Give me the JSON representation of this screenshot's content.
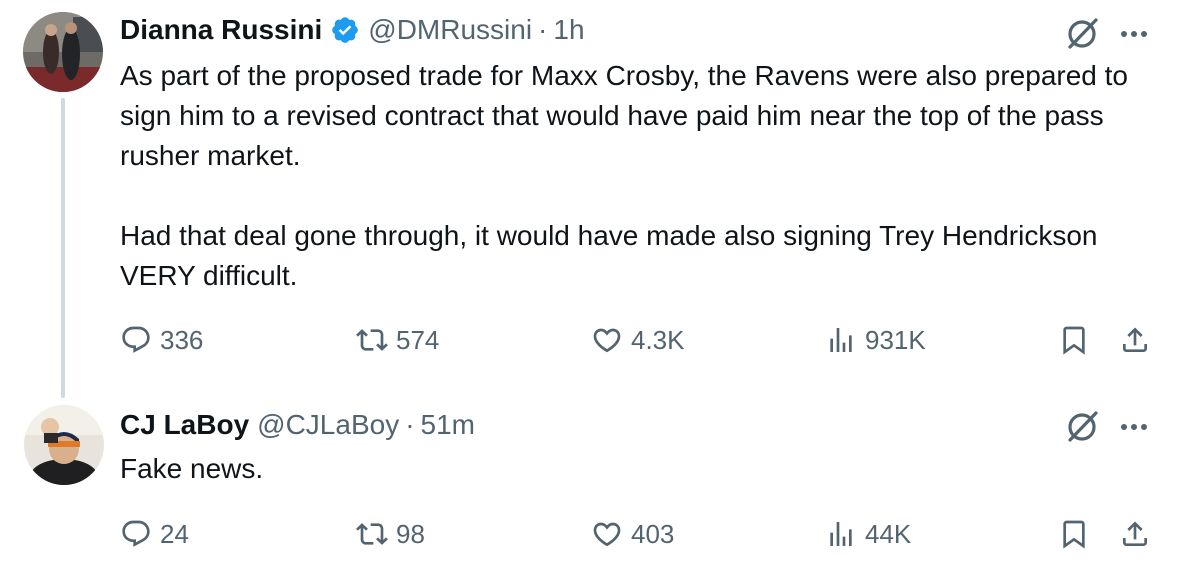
{
  "tweets": [
    {
      "name": "Dianna Russini",
      "handle": "@DMRussini",
      "separator": "·",
      "time": "1h",
      "text": [
        "As part of the proposed trade for Maxx Crosby, the Ravens were also prepared to sign him to a revised contract that would have paid him near the top of the pass rusher market.",
        "Had that deal gone through, it would have made also signing Trey Hendrickson VERY difficult."
      ],
      "replies": "336",
      "reposts": "574",
      "likes": "4.3K",
      "views": "931K"
    },
    {
      "name": "CJ LaBoy",
      "handle": "@CJLaBoy",
      "separator": "·",
      "time": "51m",
      "text": [
        "Fake news."
      ],
      "replies": "24",
      "reposts": "98",
      "likes": "403",
      "views": "44K"
    }
  ],
  "colors": {
    "text": "#0f1419",
    "secondary": "#536471",
    "verified": "#1d9bf0",
    "thread_line": "#cfd9de"
  },
  "icons": [
    "verified-badge-icon",
    "grok-icon",
    "more-icon",
    "reply-icon",
    "repost-icon",
    "like-icon",
    "views-icon",
    "bookmark-icon",
    "share-icon"
  ]
}
